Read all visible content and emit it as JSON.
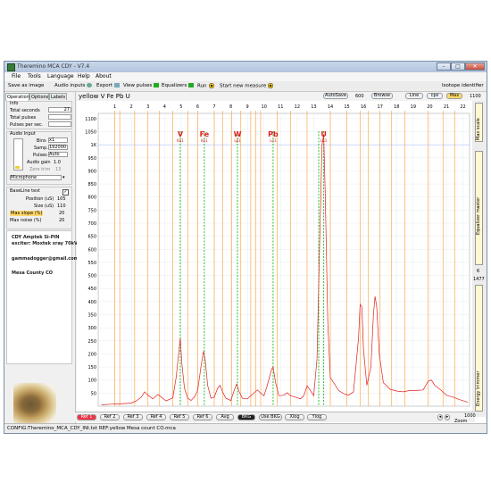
{
  "window": {
    "title": "Theremino MCA CDY - V7.4"
  },
  "menu": [
    "File",
    "Tools",
    "Language",
    "Help",
    "About"
  ],
  "toolbar": {
    "save_image": "Save as image",
    "audio_inputs": "Audio inputs",
    "export": "Export",
    "view_pulses": "View pulses",
    "equalizers": "Equalizers",
    "run": "Run",
    "new_measure": "Start new measure",
    "isotope_identifier": "Isotope identifier"
  },
  "tabs": [
    "Operation",
    "Options",
    "Labels"
  ],
  "info": {
    "header": "Info",
    "total_seconds_label": "Total seconds",
    "total_seconds": "27",
    "total_pulses_label": "Total pulses",
    "total_pulses": "",
    "pulses_per_sec_label": "Pulses per sec.",
    "pulses_per_sec": ""
  },
  "audio": {
    "header": "Audio Input",
    "bins_label": "Bins",
    "bins": "x1",
    "samp_label": "Samp.",
    "samp": "192000",
    "pulses_label": "Pulses",
    "pulses": "Auto",
    "gain_label": "Audio gain",
    "gain": "1.0",
    "zero_trim_label": "Zero trim",
    "zero_trim": "13",
    "device": "Microphone"
  },
  "baseline": {
    "header": "BaseLine test",
    "position_label": "Position (uS)",
    "position": "105",
    "size_label": "Size (uS)",
    "size": "110",
    "max_slope_label": "Max slope (%)",
    "max_slope": "20",
    "max_noise_label": "Max noise (%)",
    "max_noise": "20"
  },
  "notes": [
    "CDY Amptek Si-PIN",
    "exciter: Moxtek xray 70kV",
    "gammadogger@gmail.com",
    "Mesa County CO"
  ],
  "plot": {
    "title": "yellow V Fe Pb U",
    "autosave": "AutoSave",
    "autosave_value": "600",
    "browse": "Browse",
    "line": "Line",
    "cps": "cps",
    "max": "Max",
    "max_value": "1100"
  },
  "sidebar": {
    "max_scale": "Max scale",
    "equalizer_master": "Equalizer master",
    "eq_value": "6",
    "eq_value2": "1477",
    "energy_trimmer": "Energy trimmer"
  },
  "bottom": {
    "refs": [
      "Ref 1",
      "Ref 2",
      "Ref 3",
      "Ref 4",
      "Ref 5",
      "Ref 6",
      "Avg",
      "BKG",
      "Use BKG",
      "Xlog",
      "Ylog"
    ],
    "zoom_label": "Zoom",
    "zoom_value": "1000"
  },
  "status": "CONFIG:Theremino_MCA_CDY_INI.txt   REF:yellow Mesa count CO.mca",
  "colors": {
    "spectrum": "#e02020",
    "marker": "#ff9a2a",
    "green_marker": "#2bbf2b",
    "element_label": "#e02020"
  },
  "chart_data": {
    "type": "line",
    "title": "yellow V Fe Pb U",
    "x_ticks": [
      1,
      2,
      3,
      4,
      5,
      6,
      7,
      8,
      9,
      10,
      11,
      12,
      13,
      14,
      15,
      16,
      17,
      18,
      19,
      20,
      21,
      22
    ],
    "y_ticks": [
      50,
      100,
      150,
      200,
      250,
      300,
      350,
      400,
      450,
      500,
      550,
      600,
      650,
      700,
      750,
      800,
      850,
      900,
      950,
      "1K",
      1050,
      1100
    ],
    "xlim": [
      0,
      22.4
    ],
    "ylim": [
      0,
      1120
    ],
    "element_labels": [
      {
        "label": "V",
        "sub": "Kα1",
        "x": 4.95
      },
      {
        "label": "Fe",
        "sub": "Kα1",
        "x": 6.4
      },
      {
        "label": "W",
        "sub": "Lβ1",
        "x": 8.4
      },
      {
        "label": "Pb",
        "sub": "Lα1",
        "x": 10.55
      },
      {
        "label": "U",
        "sub": "Lα1",
        "x": 13.6
      }
    ],
    "green_markers": [
      4.95,
      6.4,
      8.4,
      10.55,
      13.3,
      13.6
    ],
    "orange_markers": [
      1.0,
      1.3,
      2.2,
      3.0,
      3.7,
      4.5,
      5.4,
      6.0,
      7.0,
      7.5,
      8.05,
      8.6,
      9.2,
      9.5,
      9.8,
      10.8,
      11.6,
      12.6,
      14.0,
      15.0,
      15.8,
      16.3,
      17.0,
      17.7,
      18.5,
      19.9,
      20.8,
      21.5
    ],
    "series": [
      {
        "points": [
          [
            0.2,
            5
          ],
          [
            0.8,
            8
          ],
          [
            1.5,
            10
          ],
          [
            2.0,
            12
          ],
          [
            2.3,
            20
          ],
          [
            2.6,
            35
          ],
          [
            2.8,
            55
          ],
          [
            3.0,
            42
          ],
          [
            3.3,
            28
          ],
          [
            3.6,
            45
          ],
          [
            3.8,
            35
          ],
          [
            4.1,
            20
          ],
          [
            4.5,
            32
          ],
          [
            4.7,
            110
          ],
          [
            4.85,
            200
          ],
          [
            4.95,
            260
          ],
          [
            5.05,
            160
          ],
          [
            5.2,
            70
          ],
          [
            5.4,
            30
          ],
          [
            5.6,
            22
          ],
          [
            5.8,
            35
          ],
          [
            6.0,
            60
          ],
          [
            6.2,
            150
          ],
          [
            6.35,
            210
          ],
          [
            6.45,
            180
          ],
          [
            6.6,
            80
          ],
          [
            6.8,
            30
          ],
          [
            7.0,
            35
          ],
          [
            7.2,
            68
          ],
          [
            7.35,
            80
          ],
          [
            7.5,
            55
          ],
          [
            7.7,
            30
          ],
          [
            8.0,
            22
          ],
          [
            8.2,
            60
          ],
          [
            8.35,
            85
          ],
          [
            8.5,
            55
          ],
          [
            8.7,
            30
          ],
          [
            9.0,
            28
          ],
          [
            9.3,
            45
          ],
          [
            9.6,
            62
          ],
          [
            9.8,
            50
          ],
          [
            10.0,
            40
          ],
          [
            10.2,
            80
          ],
          [
            10.45,
            140
          ],
          [
            10.55,
            150
          ],
          [
            10.7,
            90
          ],
          [
            10.9,
            40
          ],
          [
            11.2,
            42
          ],
          [
            11.4,
            52
          ],
          [
            11.6,
            40
          ],
          [
            11.9,
            35
          ],
          [
            12.2,
            28
          ],
          [
            12.4,
            40
          ],
          [
            12.6,
            78
          ],
          [
            12.8,
            60
          ],
          [
            13.0,
            40
          ],
          [
            13.2,
            180
          ],
          [
            13.35,
            600
          ],
          [
            13.5,
            1000
          ],
          [
            13.6,
            1040
          ],
          [
            13.7,
            800
          ],
          [
            13.85,
            320
          ],
          [
            14.0,
            110
          ],
          [
            14.3,
            80
          ],
          [
            14.5,
            60
          ],
          [
            14.8,
            48
          ],
          [
            15.1,
            42
          ],
          [
            15.4,
            55
          ],
          [
            15.7,
            260
          ],
          [
            15.8,
            390
          ],
          [
            15.9,
            380
          ],
          [
            16.0,
            220
          ],
          [
            16.2,
            80
          ],
          [
            16.45,
            150
          ],
          [
            16.6,
            350
          ],
          [
            16.7,
            420
          ],
          [
            16.8,
            380
          ],
          [
            16.95,
            200
          ],
          [
            17.2,
            90
          ],
          [
            17.6,
            65
          ],
          [
            18.0,
            58
          ],
          [
            18.4,
            55
          ],
          [
            18.8,
            60
          ],
          [
            19.2,
            60
          ],
          [
            19.6,
            62
          ],
          [
            19.9,
            95
          ],
          [
            20.1,
            100
          ],
          [
            20.3,
            80
          ],
          [
            20.7,
            60
          ],
          [
            21.0,
            42
          ],
          [
            21.4,
            35
          ],
          [
            21.8,
            25
          ],
          [
            22.3,
            15
          ]
        ]
      }
    ],
    "grid": true,
    "xlabel": "",
    "ylabel": ""
  }
}
